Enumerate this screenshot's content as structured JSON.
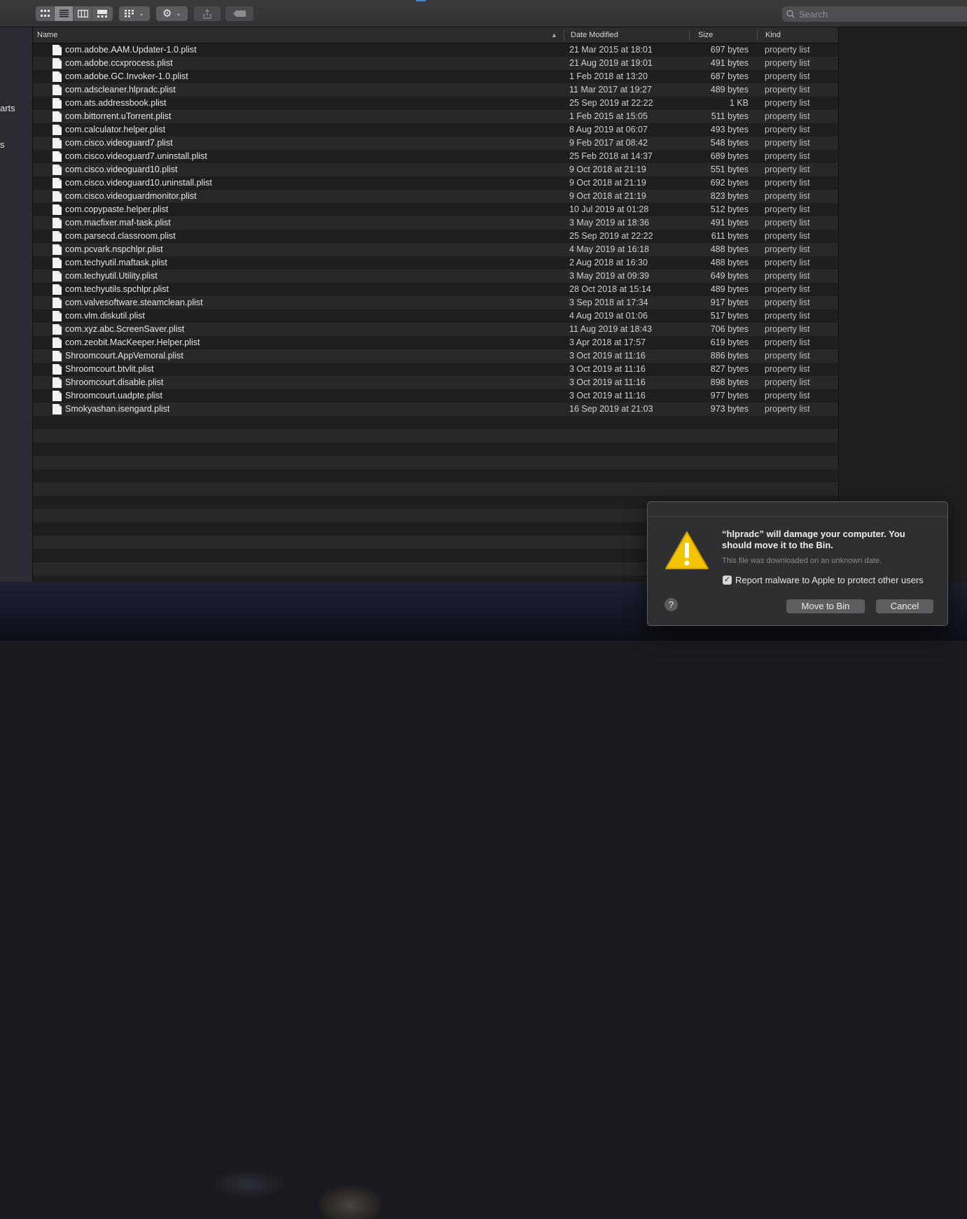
{
  "toolbar": {
    "view_icons": [
      "icon-view-icon",
      "list-view-icon",
      "column-view-icon",
      "gallery-view-icon"
    ],
    "group_icon": "group-by-icon",
    "action_icon": "gear-icon",
    "share_icon": "share-icon",
    "tag_icon": "tag-icon"
  },
  "search": {
    "placeholder": "Search"
  },
  "sidebar": {
    "fragments": [
      "arts",
      "s"
    ]
  },
  "columns": {
    "name": "Name",
    "date": "Date Modified",
    "size": "Size",
    "kind": "Kind"
  },
  "files": [
    {
      "name": "com.adobe.AAM.Updater-1.0.plist",
      "date": "21 Mar 2015 at 18:01",
      "size": "697 bytes",
      "kind": "property list"
    },
    {
      "name": "com.adobe.ccxprocess.plist",
      "date": "21 Aug 2019 at 19:01",
      "size": "491 bytes",
      "kind": "property list"
    },
    {
      "name": "com.adobe.GC.Invoker-1.0.plist",
      "date": "1 Feb 2018 at 13:20",
      "size": "687 bytes",
      "kind": "property list"
    },
    {
      "name": "com.adscleaner.hlpradc.plist",
      "date": "11 Mar 2017 at 19:27",
      "size": "489 bytes",
      "kind": "property list"
    },
    {
      "name": "com.ats.addressbook.plist",
      "date": "25 Sep 2019 at 22:22",
      "size": "1 KB",
      "kind": "property list"
    },
    {
      "name": "com.bittorrent.uTorrent.plist",
      "date": "1 Feb 2015 at 15:05",
      "size": "511 bytes",
      "kind": "property list"
    },
    {
      "name": "com.calculator.helper.plist",
      "date": "8 Aug 2019 at 06:07",
      "size": "493 bytes",
      "kind": "property list"
    },
    {
      "name": "com.cisco.videoguard7.plist",
      "date": "9 Feb 2017 at 08:42",
      "size": "548 bytes",
      "kind": "property list"
    },
    {
      "name": "com.cisco.videoguard7.uninstall.plist",
      "date": "25 Feb 2018 at 14:37",
      "size": "689 bytes",
      "kind": "property list"
    },
    {
      "name": "com.cisco.videoguard10.plist",
      "date": "9 Oct 2018 at 21:19",
      "size": "551 bytes",
      "kind": "property list"
    },
    {
      "name": "com.cisco.videoguard10.uninstall.plist",
      "date": "9 Oct 2018 at 21:19",
      "size": "692 bytes",
      "kind": "property list"
    },
    {
      "name": "com.cisco.videoguardmonitor.plist",
      "date": "9 Oct 2018 at 21:19",
      "size": "823 bytes",
      "kind": "property list"
    },
    {
      "name": "com.copypaste.helper.plist",
      "date": "10 Jul 2019 at 01:28",
      "size": "512 bytes",
      "kind": "property list"
    },
    {
      "name": "com.macfixer.maf-task.plist",
      "date": "3 May 2019 at 18:36",
      "size": "491 bytes",
      "kind": "property list"
    },
    {
      "name": "com.parsecd.classroom.plist",
      "date": "25 Sep 2019 at 22:22",
      "size": "611 bytes",
      "kind": "property list"
    },
    {
      "name": "com.pcvark.nspchlpr.plist",
      "date": "4 May 2019 at 16:18",
      "size": "488 bytes",
      "kind": "property list"
    },
    {
      "name": "com.techyutil.maftask.plist",
      "date": "2 Aug 2018 at 16:30",
      "size": "488 bytes",
      "kind": "property list"
    },
    {
      "name": "com.techyutil.Utility.plist",
      "date": "3 May 2019 at 09:39",
      "size": "649 bytes",
      "kind": "property list"
    },
    {
      "name": "com.techyutils.spchlpr.plist",
      "date": "28 Oct 2018 at 15:14",
      "size": "489 bytes",
      "kind": "property list"
    },
    {
      "name": "com.valvesoftware.steamclean.plist",
      "date": "3 Sep 2018 at 17:34",
      "size": "917 bytes",
      "kind": "property list"
    },
    {
      "name": "com.vlm.diskutil.plist",
      "date": "4 Aug 2019 at 01:06",
      "size": "517 bytes",
      "kind": "property list"
    },
    {
      "name": "com.xyz.abc.ScreenSaver.plist",
      "date": "11 Aug 2019 at 18:43",
      "size": "706 bytes",
      "kind": "property list"
    },
    {
      "name": "com.zeobit.MacKeeper.Helper.plist",
      "date": "3 Apr 2018 at 17:57",
      "size": "619 bytes",
      "kind": "property list"
    },
    {
      "name": "Shroomcourt.AppVemoral.plist",
      "date": "3 Oct 2019 at 11:16",
      "size": "886 bytes",
      "kind": "property list"
    },
    {
      "name": "Shroomcourt.btvlit.plist",
      "date": "3 Oct 2019 at 11:16",
      "size": "827 bytes",
      "kind": "property list"
    },
    {
      "name": "Shroomcourt.disable.plist",
      "date": "3 Oct 2019 at 11:16",
      "size": "898 bytes",
      "kind": "property list"
    },
    {
      "name": "Shroomcourt.uadpte.plist",
      "date": "3 Oct 2019 at 11:16",
      "size": "977 bytes",
      "kind": "property list"
    },
    {
      "name": "Smokyashan.isengard.plist",
      "date": "16 Sep 2019 at 21:03",
      "size": "973 bytes",
      "kind": "property list"
    }
  ],
  "alert": {
    "title": "“hlpradc” will damage your computer. You should move it to the Bin.",
    "subtitle": "This file was downloaded on an unknown date.",
    "checkbox_label": "Report malware to Apple to protect other users",
    "checkbox_checked": true,
    "help_label": "?",
    "move_button": "Move to Bin",
    "cancel_button": "Cancel"
  }
}
